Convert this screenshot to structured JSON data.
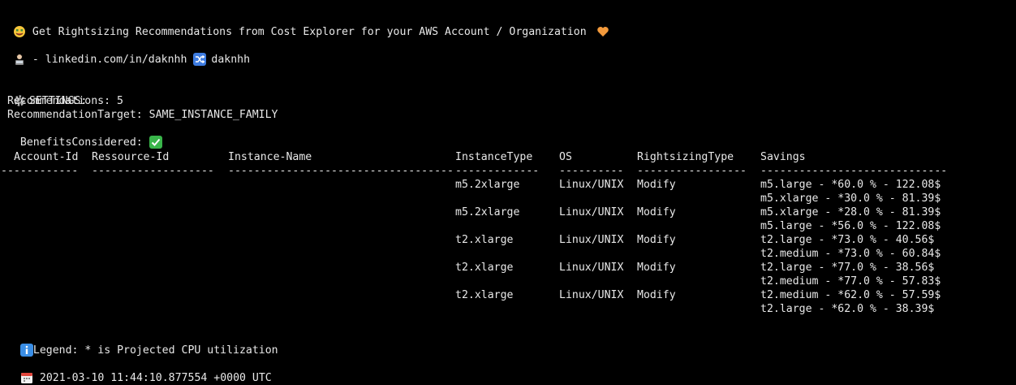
{
  "header": {
    "title": "Get Rightsizing Recommendations from Cost Explorer for your AWS Account / Organization",
    "author_link": "- linkedin.com/in/daknhh",
    "author_handle": "daknhh"
  },
  "settings": {
    "heading": "SETTINGS:",
    "recommendations": "Recommendations: 5",
    "target": "RecommendationTarget: SAME_INSTANCE_FAMILY",
    "benefits": "BenefitsConsidered:"
  },
  "table": {
    "headers": [
      "Account-Id",
      "Ressource-Id",
      "Instance-Name",
      "InstanceType",
      "OS",
      "RightsizingType",
      "Savings"
    ],
    "separators": [
      "------------",
      "-------------------",
      "-----------------------------------",
      "-------------",
      "----------",
      "-----------------",
      "-----------------------------"
    ],
    "rows": [
      {
        "instance_type": "m5.2xlarge",
        "os": "Linux/UNIX",
        "type": "Modify",
        "savings": [
          "m5.large - *60.0 % - 122.08$",
          "m5.xlarge - *30.0 % - 81.39$"
        ]
      },
      {
        "instance_type": "m5.2xlarge",
        "os": "Linux/UNIX",
        "type": "Modify",
        "savings": [
          "m5.xlarge - *28.0 % - 81.39$",
          "m5.large - *56.0 % - 122.08$"
        ]
      },
      {
        "instance_type": "t2.xlarge",
        "os": "Linux/UNIX",
        "type": "Modify",
        "savings": [
          "t2.large - *73.0 % - 40.56$",
          "t2.medium - *73.0 % - 60.84$"
        ]
      },
      {
        "instance_type": "t2.xlarge",
        "os": "Linux/UNIX",
        "type": "Modify",
        "savings": [
          "t2.large - *77.0 % - 38.56$",
          "t2.medium - *77.0 % - 57.83$"
        ]
      },
      {
        "instance_type": "t2.xlarge",
        "os": "Linux/UNIX",
        "type": "Modify",
        "savings": [
          "t2.medium - *62.0 % - 57.59$",
          "t2.large - *62.0 % - 38.39$"
        ]
      }
    ]
  },
  "legend": "Legend: * is Projected CPU utilization",
  "timestamp": "2021-03-10 11:44:10.877554 +0000 UTC",
  "icons": {
    "title": "money-mouth-face-icon",
    "heart": "orange-heart-icon",
    "author": "technologist-icon",
    "shuffle": "shuffle-icon",
    "settings": "gear-icon",
    "check": "check-mark-button-icon",
    "info": "information-icon",
    "calendar": "calendar-icon"
  },
  "colors": {
    "background": "#000000",
    "text": "#e8e8e8",
    "heart": "#f39a3c",
    "check": "#39b54a",
    "info": "#3a8ee6"
  }
}
